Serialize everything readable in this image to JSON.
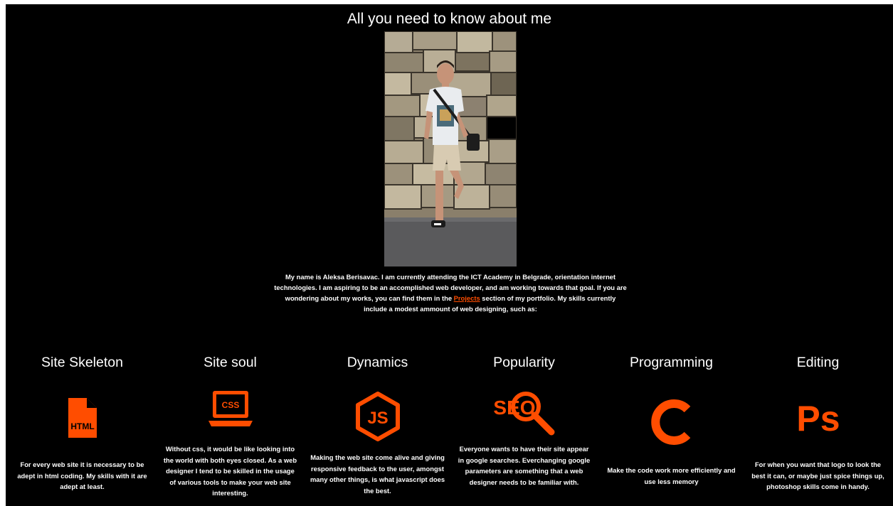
{
  "page": {
    "heading": "All you need to know about me",
    "intro": {
      "before_link": "My name is Aleksa Berisavac. I am currently attending the ICT Academy in Belgrade, orientation internet technologies. I am aspiring to be an accomplished web developer, and am working towards that goal. If you are wondering about my works, you can find them in the ",
      "link_label": "Projects",
      "after_link": " section of my portfolio. My skills currently include a modest ammount of web designing, such as:"
    }
  },
  "skills": [
    {
      "title": "Site Skeleton",
      "icon": "html-file-icon",
      "icon_text": "HTML",
      "description": "For every web site it is necessary to be adept in html coding. My skills with it are adept at least."
    },
    {
      "title": "Site soul",
      "icon": "css-laptop-icon",
      "icon_text": "CSS",
      "description": "Without css, it would be like looking into the world with both eyes closed. As a web designer I tend to be skilled in the usage of various tools to make your web site interesting."
    },
    {
      "title": "Dynamics",
      "icon": "nodejs-hexagon-icon",
      "icon_text": "JS",
      "description": "Making the web site come alive and giving responsive feedback to the user, amongst many other things, is what javascript does the best."
    },
    {
      "title": "Popularity",
      "icon": "seo-magnifier-icon",
      "icon_text": "SEO",
      "description": "Everyone wants to have their site appear in google searches. Everchanging google parameters are something that a web designer needs to be familiar with."
    },
    {
      "title": "Programming",
      "icon": "c-language-icon",
      "icon_text": "C",
      "description": "Make the code work more efficiently and use less memory"
    },
    {
      "title": "Editing",
      "icon": "photoshop-icon",
      "icon_text": "Ps",
      "description": "For when you want that logo to look the best it can, or maybe just spice things up, photoshop skills come in handy."
    }
  ],
  "colors": {
    "background": "#000000",
    "text": "#ffffff",
    "accent": "#ff4d00"
  }
}
